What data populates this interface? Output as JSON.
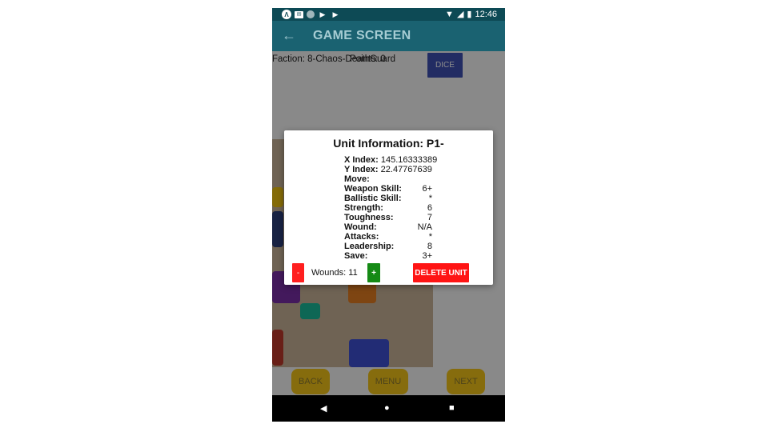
{
  "status_bar": {
    "time": "12:46",
    "icons": [
      "app-a-icon",
      "mail-icon",
      "globe-icon",
      "play-store-icon",
      "play-store-icon",
      "wifi-icon",
      "signal-icon",
      "battery-icon"
    ]
  },
  "app_bar": {
    "back_icon": "←",
    "title": "GAME SCREEN"
  },
  "header": {
    "faction_text": "Faction: 8-Chaos-DeathGuard",
    "points_text": "Points: 0",
    "dice_label": "DICE"
  },
  "nav_buttons": {
    "back": "BACK",
    "menu": "MENU",
    "next": "NEXT",
    "color": "#f5c518"
  },
  "dialog": {
    "title": "Unit Information: P1-",
    "stats": [
      {
        "label": "X Index:",
        "value": "145.16333389"
      },
      {
        "label": "Y Index:",
        "value": "22.47767639"
      },
      {
        "label": "Move:",
        "value": ""
      },
      {
        "label": "Weapon Skill:",
        "value": "6+"
      },
      {
        "label": "Ballistic Skill:",
        "value": "*"
      },
      {
        "label": "Strength:",
        "value": "6"
      },
      {
        "label": "Toughness:",
        "value": "7"
      },
      {
        "label": "Wound:",
        "value": "N/A"
      },
      {
        "label": "Attacks:",
        "value": "*"
      },
      {
        "label": "Leadership:",
        "value": "8"
      },
      {
        "label": "Save:",
        "value": "3+"
      }
    ],
    "minus_label": "-",
    "wounds_text": "Wounds: 11",
    "plus_label": "+",
    "delete_label": "DELETE UNIT",
    "delete_color": "#ff1414",
    "minus_color": "#ff1f1f",
    "plus_color": "#158a15"
  },
  "system_nav": {
    "back_icon": "◀",
    "home_icon": "●",
    "recents_icon": "■"
  }
}
